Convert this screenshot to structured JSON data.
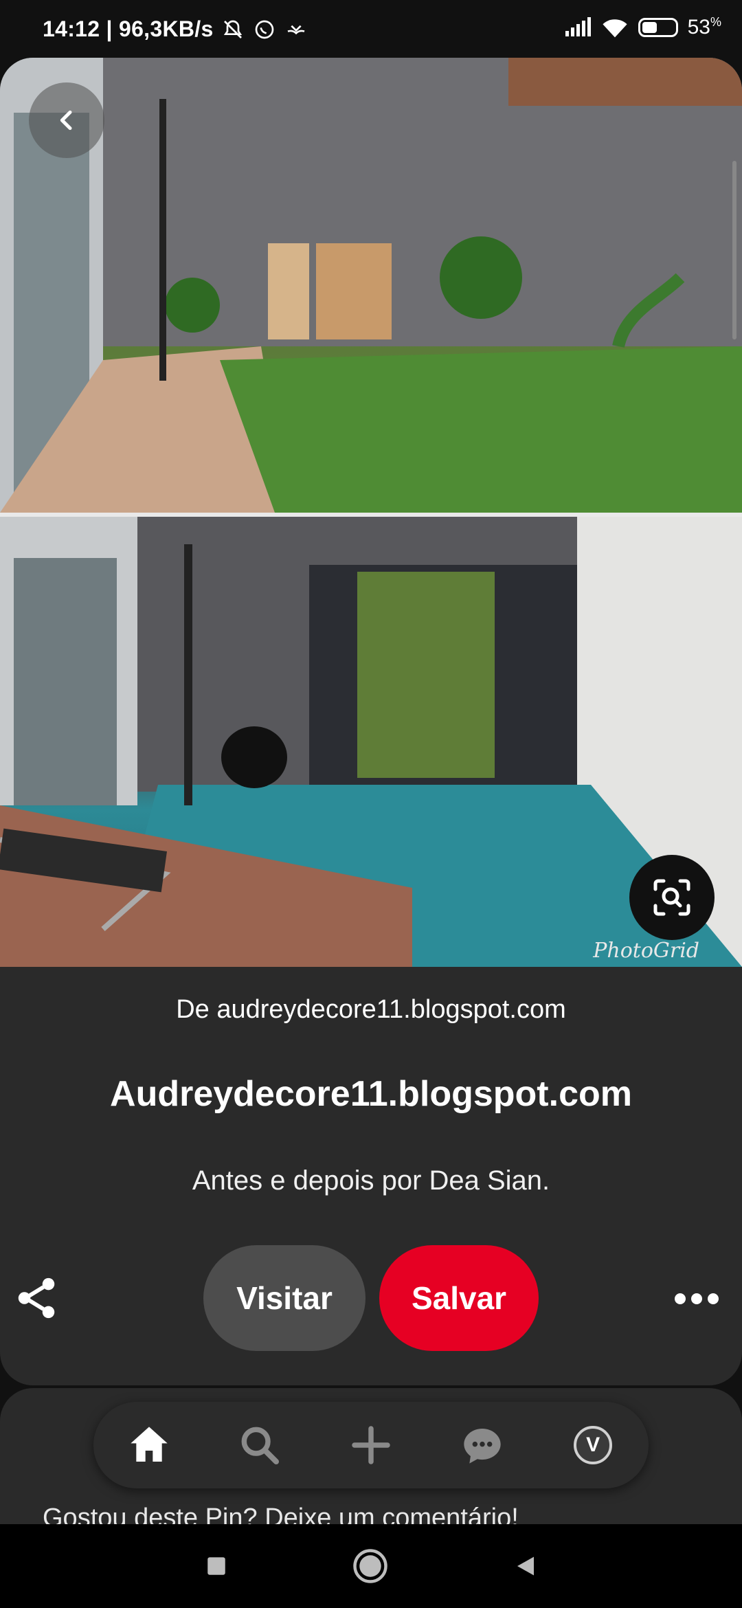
{
  "status_bar": {
    "time_speed": "14:12 | 96,3KB/s",
    "battery": "53",
    "battery_unit": "%",
    "battery_level": 0.53,
    "icons": [
      "bell-off-icon",
      "whatsapp-icon",
      "app-notification-icon",
      "signal-icon",
      "wifi-icon",
      "battery-icon"
    ]
  },
  "pin": {
    "watermark": "PhotoGrid",
    "source_prefix": "De ",
    "source_domain": "audreydecore11.blogspot.com",
    "title": "Audreydecore11.blogspot.com",
    "description": "Antes e depois por Dea Sian.",
    "visit_label": "Visitar",
    "save_label": "Salvar"
  },
  "comment_prompt": "Gostou deste Pin? Deixe um comentário!",
  "tabbar": {
    "avatar_letter": "V"
  },
  "colors": {
    "save_red": "#e60023",
    "card_bg": "#2a2a2a",
    "visit_bg": "#4d4d4d"
  }
}
